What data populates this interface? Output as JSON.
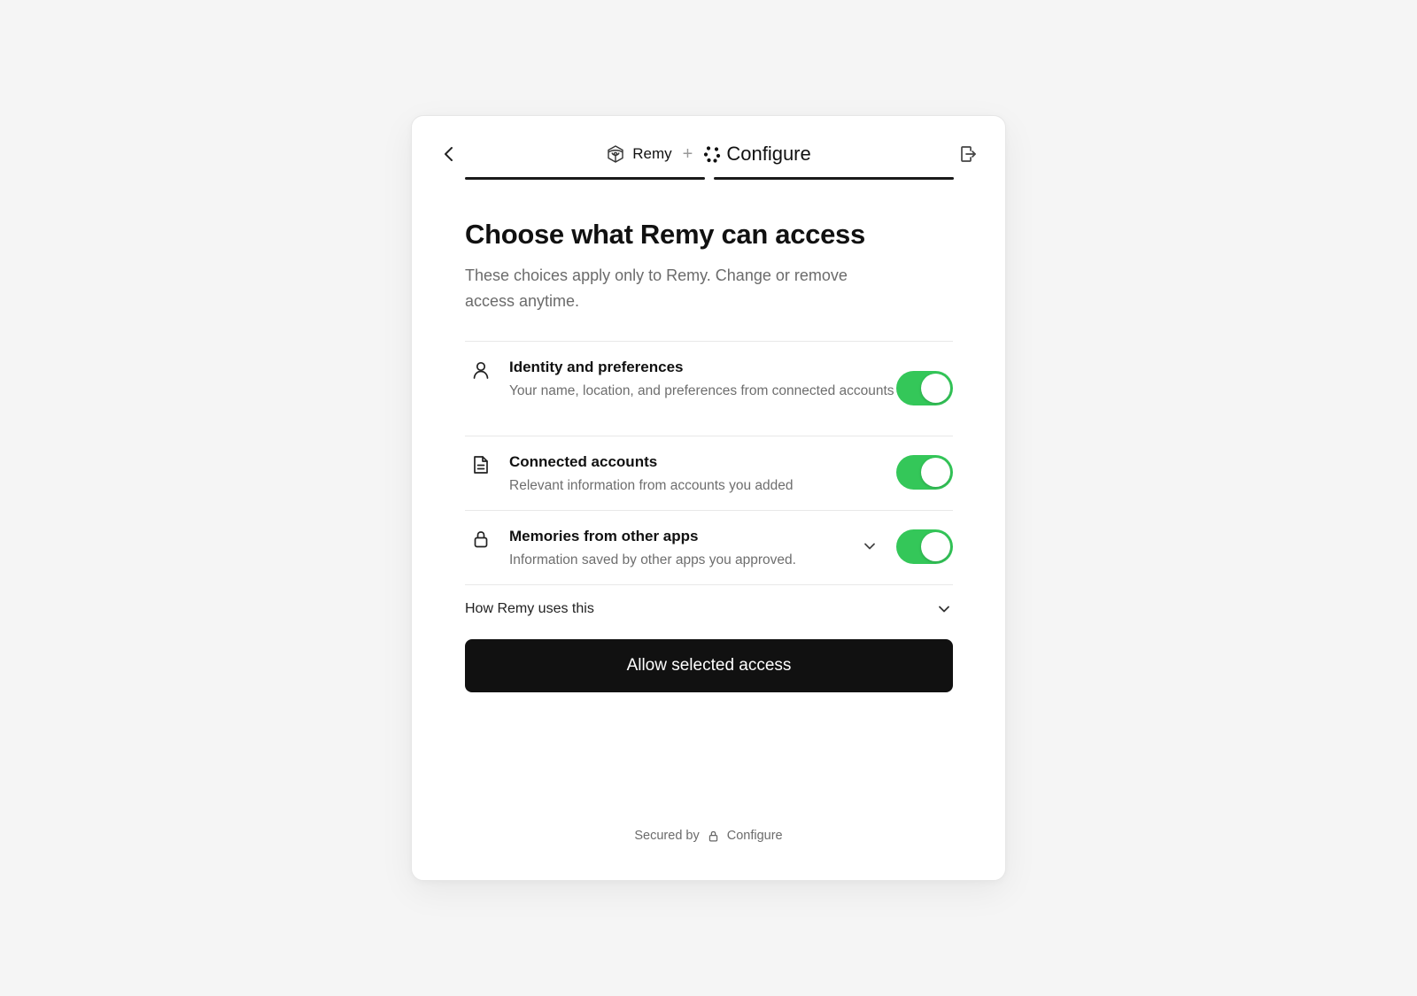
{
  "header": {
    "back_icon": "chevron-left-icon",
    "exit_icon": "exit-icon",
    "app_name": "Remy",
    "app_icon": "remy-logo-icon",
    "separator": "+",
    "provider_name": "Configure",
    "provider_icon": "configure-logo-icon"
  },
  "main": {
    "title": "Choose what Remy can access",
    "subtitle": "These choices apply only to Remy. Change or remove access anytime."
  },
  "permissions": [
    {
      "icon": "person-icon",
      "title": "Identity and preferences",
      "description": "Your name, location, and preferences from connected accounts",
      "enabled": true
    },
    {
      "icon": "document-icon",
      "title": "Connected accounts",
      "description": "Relevant information from accounts you added",
      "enabled": true
    },
    {
      "icon": "lock-icon",
      "title": "Memories from other apps",
      "description": "Information saved by other apps you approved.",
      "enabled": true,
      "expandable": true
    }
  ],
  "how_uses": {
    "label": "How Remy uses this"
  },
  "actions": {
    "allow_label": "Allow selected access"
  },
  "footer": {
    "secured_by": "Secured by",
    "provider": "Configure"
  },
  "colors": {
    "toggle_on": "#34c759",
    "primary_button": "#111111",
    "background": "#f5f5f5"
  }
}
